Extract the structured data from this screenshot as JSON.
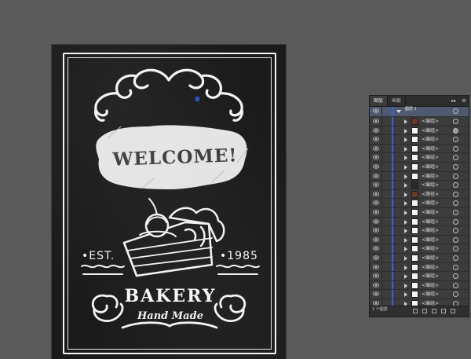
{
  "artboard": {
    "welcome": "WELCOME!",
    "est": "•EST.",
    "year": "•1985",
    "bakery": "BAKERY",
    "handmade": "Hand Made"
  },
  "layers_panel": {
    "tabs": [
      "图层",
      "画板"
    ],
    "menu_icon": "hamburger-icon",
    "collapse_icon": "double-chevron-icon",
    "top_layer": {
      "label": "图层 1"
    },
    "rows": [
      {
        "label": "<编组>",
        "thumb": "pie",
        "target_selected": false
      },
      {
        "label": "<编组>",
        "thumb": "light",
        "target_selected": true
      },
      {
        "label": "<编组>",
        "thumb": "light",
        "target_selected": false
      },
      {
        "label": "<编组>",
        "thumb": "light",
        "target_selected": false
      },
      {
        "label": "<编组>",
        "thumb": "light",
        "target_selected": false
      },
      {
        "label": "<编组>",
        "thumb": "light",
        "target_selected": false
      },
      {
        "label": "<编组>",
        "thumb": "light",
        "target_selected": false
      },
      {
        "label": "<编组>",
        "thumb": "dark",
        "target_selected": false
      },
      {
        "label": "<路径>",
        "thumb": "pie",
        "target_selected": false
      },
      {
        "label": "<编组>",
        "thumb": "light",
        "target_selected": false
      },
      {
        "label": "<编组>",
        "thumb": "light",
        "target_selected": false
      },
      {
        "label": "<编组>",
        "thumb": "light",
        "target_selected": false
      },
      {
        "label": "<编组>",
        "thumb": "light",
        "target_selected": false
      },
      {
        "label": "<编组>",
        "thumb": "light",
        "target_selected": false
      },
      {
        "label": "<编组>",
        "thumb": "light",
        "target_selected": false
      },
      {
        "label": "<编组>",
        "thumb": "light",
        "target_selected": false
      },
      {
        "label": "<编组>",
        "thumb": "light",
        "target_selected": false
      },
      {
        "label": "<编组>",
        "thumb": "light",
        "target_selected": false
      },
      {
        "label": "<编组>",
        "thumb": "light",
        "target_selected": false
      },
      {
        "label": "<编组>",
        "thumb": "light",
        "target_selected": false
      },
      {
        "label": "<编组>",
        "thumb": "light",
        "target_selected": false
      }
    ],
    "footer_count": "1 个图层"
  },
  "colors": {
    "workspace": "#5a5a5a",
    "chalkboard": "#1a1a1a",
    "layer_color": "#3e5ee0",
    "top_row": "#4f5a70"
  }
}
